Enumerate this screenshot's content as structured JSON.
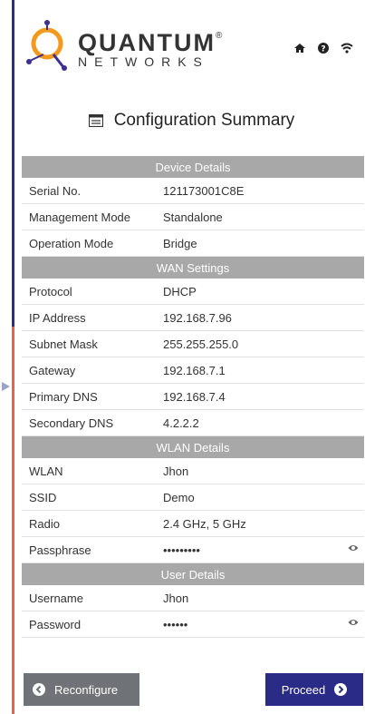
{
  "brand": {
    "word1": "QUANTUM",
    "word2": "NETWORKS",
    "reg": "®"
  },
  "header_icons": [
    "home-icon",
    "help-icon",
    "wifi-icon"
  ],
  "title": "Configuration Summary",
  "sections": {
    "device": {
      "header": "Device Details",
      "rows": [
        {
          "label": "Serial No.",
          "value": "121173001C8E"
        },
        {
          "label": "Management Mode",
          "value": "Standalone"
        },
        {
          "label": "Operation Mode",
          "value": "Bridge"
        }
      ]
    },
    "wan": {
      "header": "WAN Settings",
      "rows": [
        {
          "label": "Protocol",
          "value": "DHCP"
        },
        {
          "label": "IP Address",
          "value": "192.168.7.96"
        },
        {
          "label": "Subnet Mask",
          "value": "255.255.255.0"
        },
        {
          "label": "Gateway",
          "value": "192.168.7.1"
        },
        {
          "label": "Primary DNS",
          "value": "192.168.7.4"
        },
        {
          "label": "Secondary DNS",
          "value": "4.2.2.2"
        }
      ]
    },
    "wlan": {
      "header": "WLAN Details",
      "rows": [
        {
          "label": "WLAN",
          "value": "Jhon"
        },
        {
          "label": "SSID",
          "value": "Demo"
        },
        {
          "label": "Radio",
          "value": "2.4 GHz, 5 GHz"
        },
        {
          "label": "Passphrase",
          "value": "•••••••••"
        }
      ]
    },
    "user": {
      "header": "User Details",
      "rows": [
        {
          "label": "Username",
          "value": "Jhon"
        },
        {
          "label": "Password",
          "value": "••••••"
        }
      ]
    }
  },
  "buttons": {
    "reconfigure": "Reconfigure",
    "proceed": "Proceed"
  },
  "colors": {
    "section_bg": "#a8a8a8",
    "proceed_bg": "#2a2b86",
    "reconfigure_bg": "#6f7378",
    "logo_orange": "#f39a1e",
    "logo_purple": "#3b2f8f"
  }
}
